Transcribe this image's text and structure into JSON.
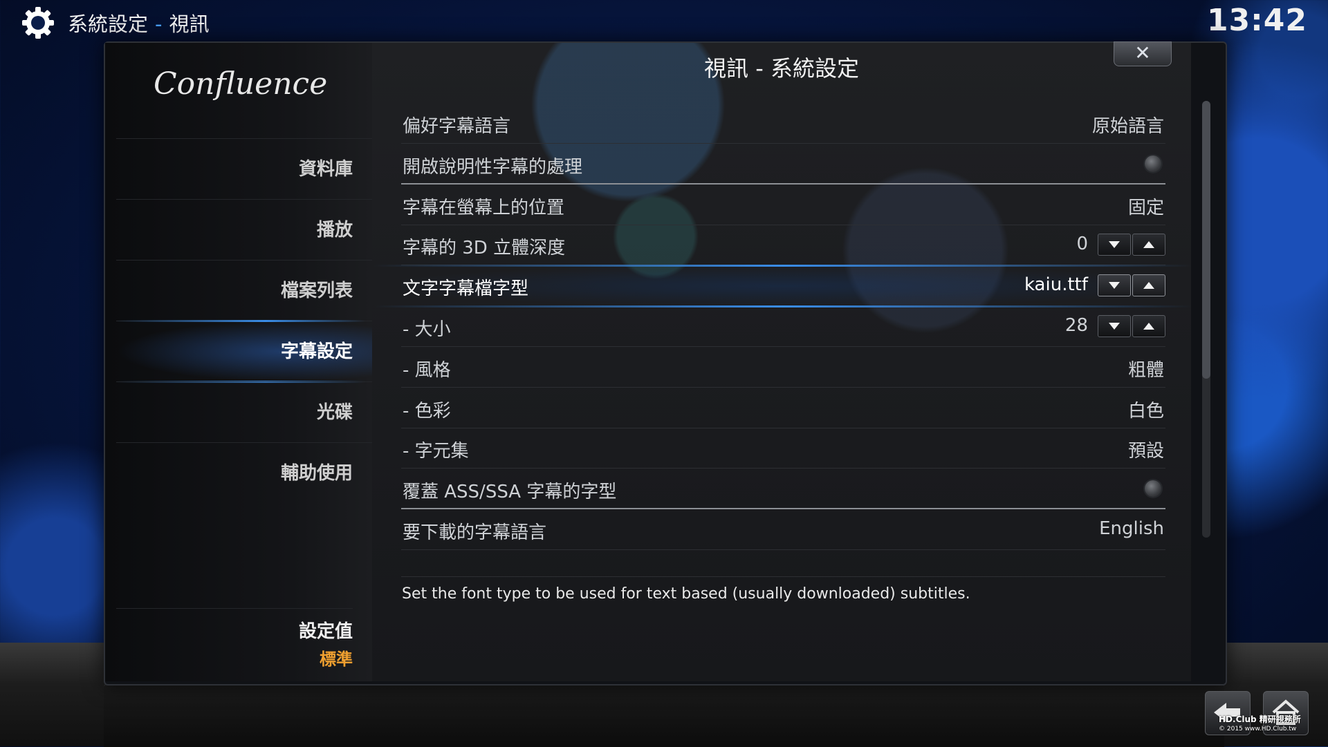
{
  "header": {
    "section": "系統設定",
    "separator": "-",
    "page": "視訊",
    "clock": "13:42"
  },
  "dialog": {
    "title": "視訊 - 系統設定",
    "close_label": "✕",
    "logo_text": "Confluence"
  },
  "sidebar": {
    "items": [
      {
        "label": "資料庫",
        "active": false
      },
      {
        "label": "播放",
        "active": false
      },
      {
        "label": "檔案列表",
        "active": false
      },
      {
        "label": "字幕設定",
        "active": true
      },
      {
        "label": "光碟",
        "active": false
      },
      {
        "label": "輔助使用",
        "active": false
      }
    ],
    "preset_label": "設定值",
    "preset_value": "標準"
  },
  "settings": [
    {
      "label": "偏好字幕語言",
      "value": "原始語言"
    },
    {
      "label": "開啟說明性字幕的處理",
      "value": "",
      "toggle_on": false
    },
    {
      "label": "字幕在螢幕上的位置",
      "value": "固定"
    },
    {
      "label": "字幕的 3D 立體深度",
      "value": "0"
    },
    {
      "label": "文字字幕檔字型",
      "value": "kaiu.ttf"
    },
    {
      "label": "- 大小",
      "value": "28"
    },
    {
      "label": "- 風格",
      "value": "粗體"
    },
    {
      "label": "- 色彩",
      "value": "白色"
    },
    {
      "label": "- 字元集",
      "value": "預設"
    },
    {
      "label": "覆蓋 ASS/SSA 字幕的字型",
      "value": "",
      "toggle_on": false
    },
    {
      "label": "要下載的字幕語言",
      "value": "English"
    }
  ],
  "scrollbar": {
    "visible_fraction": 0.64
  },
  "description": "Set the font type to be used for text based (usually downloaded) subtitles.",
  "watermark": {
    "line1": "HD.Club 精研視務所",
    "line2": "© 2015  www.HD.Club.tw"
  },
  "colors": {
    "accent_blue": "#3a8de8",
    "preset_orange": "#f0a030",
    "header_separator": "#4aa0ff"
  },
  "icons": {
    "top_left": "gear-icon",
    "close": "close-icon",
    "nav_back": "back-arrow-icon",
    "nav_home": "home-icon"
  }
}
